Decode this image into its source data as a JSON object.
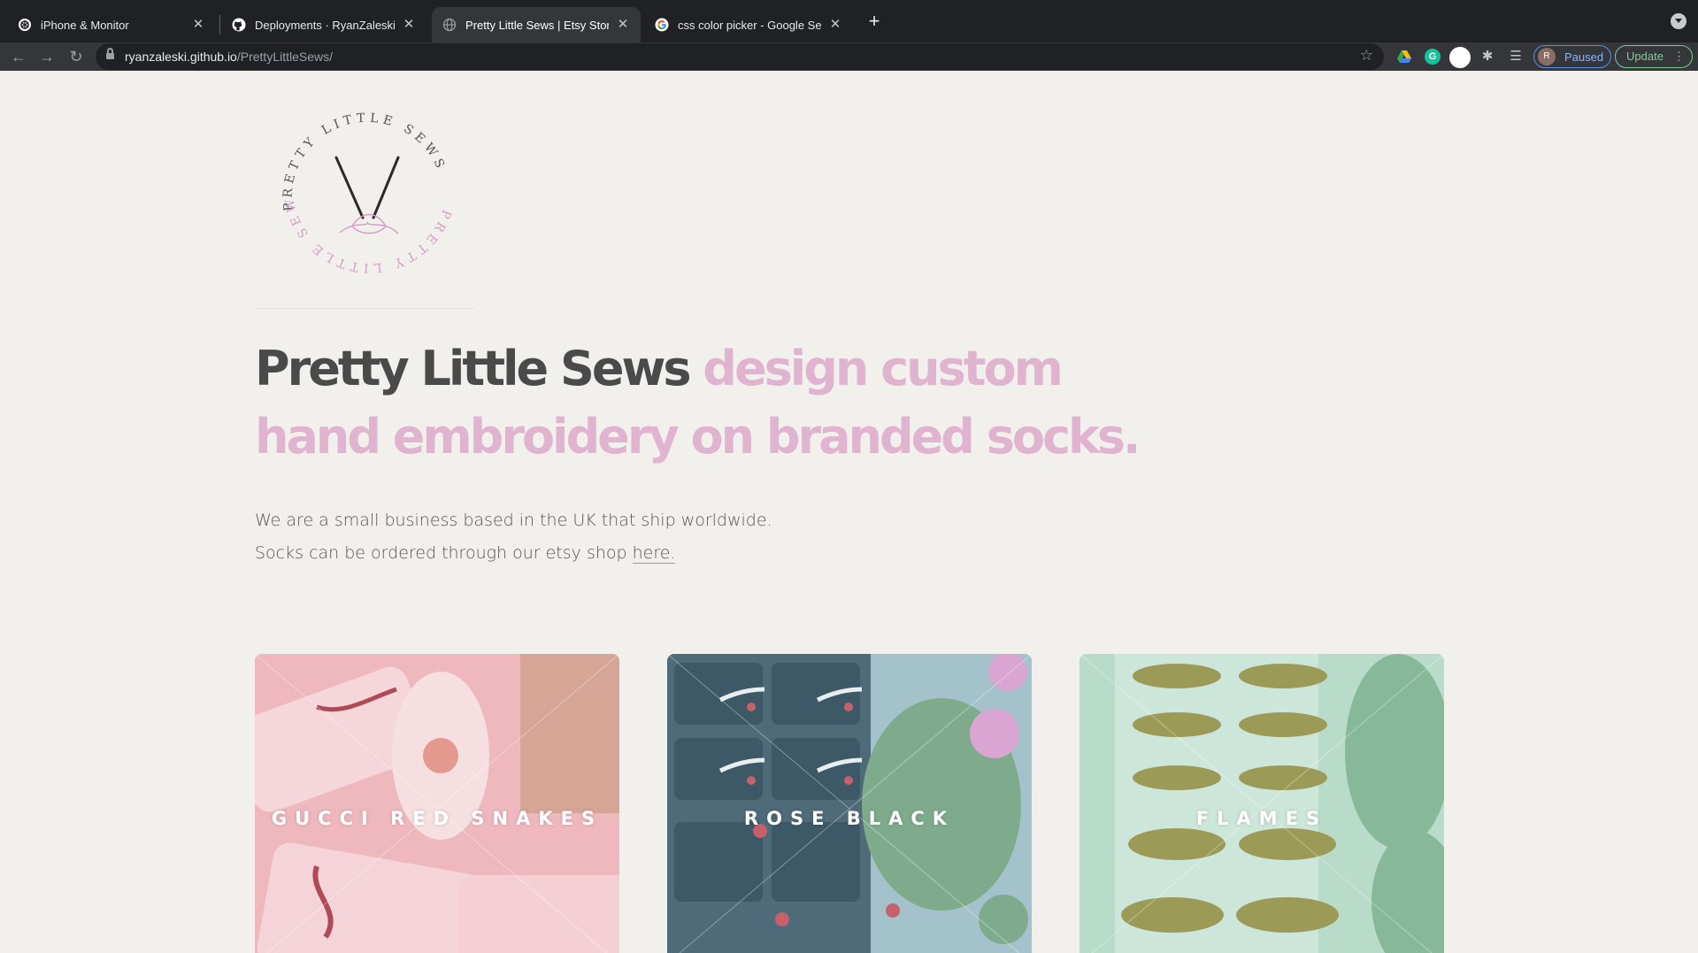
{
  "browser": {
    "tabs": [
      {
        "title": "iPhone & Monitor",
        "icon": "chatgpt-icon",
        "active": false
      },
      {
        "title": "Deployments · RyanZaleski/PrettyLittleSews",
        "icon": "github-icon",
        "active": false
      },
      {
        "title": "Pretty Little Sews | Etsy Store",
        "icon": "globe-icon",
        "active": true
      },
      {
        "title": "css color picker - Google Search",
        "icon": "google-icon",
        "active": false
      }
    ],
    "url_host": "ryanzaleski.github.io",
    "url_path": "/PrettyLittleSews/",
    "profile_initial": "R",
    "profile_status": "Paused",
    "update_label": "Update",
    "grammarly_letter": "G"
  },
  "page": {
    "logo_text_top": "PRETTY LITTLE SEWS",
    "logo_text_bottom": "PRETTY LITTLE SEWS",
    "headline_brand": "Pretty Little Sews",
    "headline_tagline": "design custom hand embroidery on branded socks.",
    "intro_line1": "We are a small business based in the UK that ship worldwide.",
    "intro_line2_prefix": "Socks can be ordered through our etsy shop ",
    "intro_link": "here.",
    "cards": [
      {
        "label": "GUCCI RED SNAKES",
        "tint": "#efb8bf"
      },
      {
        "label": "ROSE BLACK",
        "tint": "#a4c2cb"
      },
      {
        "label": "FLAMES",
        "tint": "#b8dcc9"
      }
    ]
  },
  "colors": {
    "brand_text": "#4a4a4a",
    "accent_pink": "#e0b4cf",
    "page_bg": "#f1f0ed",
    "chrome_dark": "#202124"
  }
}
